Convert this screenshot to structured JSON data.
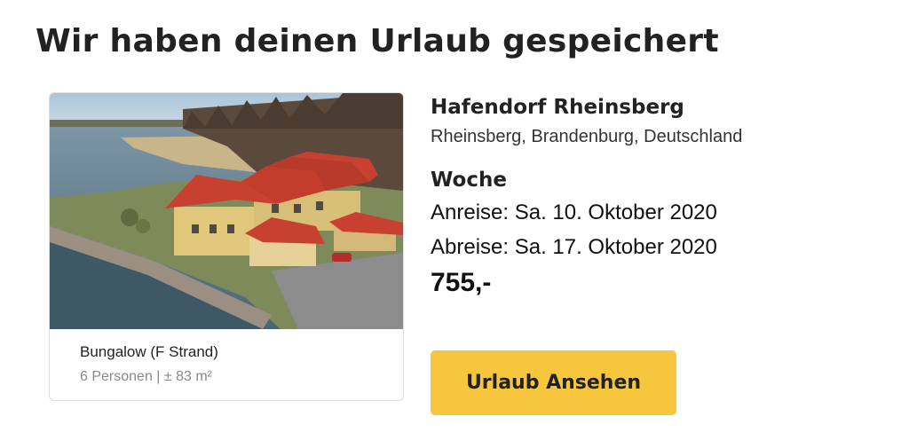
{
  "heading": "Wir haben deinen Urlaub gespeichert",
  "card": {
    "accommodation": "Bungalow (F Strand)",
    "details": "6 Personen | ± 83 m²"
  },
  "park": {
    "name": "Hafendorf Rheinsberg",
    "location": "Rheinsberg, Brandenburg, Deutschland"
  },
  "stay": {
    "duration": "Woche",
    "arrival": "Anreise: Sa. 10. Oktober 2020",
    "departure": "Abreise: Sa. 17. Oktober 2020",
    "price": "755,-"
  },
  "cta": {
    "label": "Urlaub Ansehen"
  },
  "colors": {
    "button": "#f6c63d",
    "roof": "#c8402f",
    "water": "#56707d"
  }
}
